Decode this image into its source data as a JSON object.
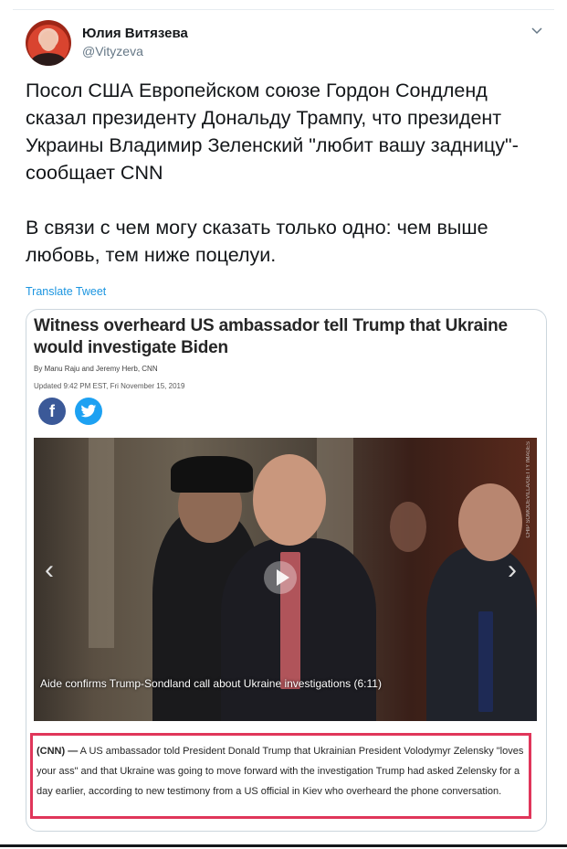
{
  "author": {
    "name": "Юлия Витязева",
    "handle": "@Vityzeva"
  },
  "tweet": {
    "text": "Посол США Европейском союзе Гордон Сондленд сказал президенту Дональду Трампу, что президент Украины Владимир Зеленский \"любит вашу задницу\"- сообщает CNN\n\nВ связи с чем могу сказать только одно: чем выше любовь, тем ниже поцелуи.",
    "translate_label": "Translate Tweet"
  },
  "article": {
    "headline": "Witness overheard US ambassador tell Trump that Ukraine would investigate Biden",
    "byline": "By Manu Raju and Jeremy Herb, CNN",
    "updated": "Updated 9:42 PM EST, Fri November 15, 2019",
    "share_icons": [
      "facebook-icon",
      "twitter-icon"
    ],
    "photo_caption": "Aide confirms Trump-Sondland call about Ukraine investigations (6:11)",
    "photo_credit": "CHIP SOMODEVILLA/GETTY IMAGES",
    "excerpt_lead": "(CNN) —",
    "excerpt_body": " A US ambassador told President Donald Trump that Ukrainian President Volodymyr Zelensky \"loves your ass\" and that Ukraine was going to move forward with the investigation Trump had asked Zelensky for a day earlier, according to new testimony from a US official in Kiev who overheard the phone conversation."
  },
  "colors": {
    "link": "#1b95e0",
    "highlight_border": "#e0365a",
    "facebook": "#3b5998",
    "twitter": "#1da1f2"
  }
}
